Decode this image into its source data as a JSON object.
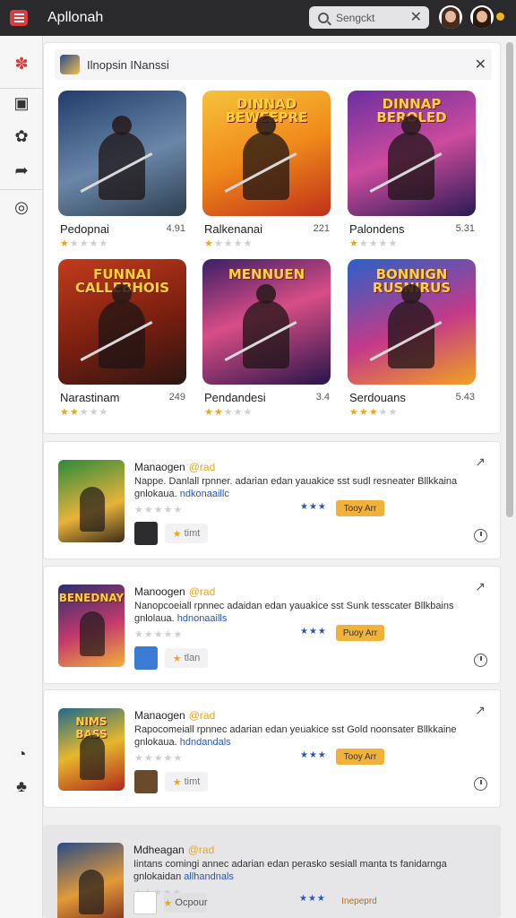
{
  "app": {
    "title": "Apllonah"
  },
  "search": {
    "value": "Sengckt"
  },
  "panel": {
    "title": "Ilnopsin INanssi"
  },
  "games": [
    {
      "name": "Pedopnai",
      "rating": "4.91",
      "stars": 1,
      "logo": "",
      "bg": "linear-gradient(160deg,#1f3e6a,#6a86a8 55%,#2c3f4f)"
    },
    {
      "name": "Ralkenanai",
      "rating": "221",
      "stars": 1,
      "logo": "DINNAD BEWEEPRE",
      "bg": "linear-gradient(160deg,#f7c33b,#f08a1a 50%,#c0301a)"
    },
    {
      "name": "Palondens",
      "rating": "5.31",
      "stars": 1,
      "logo": "DINNAP BEROLED",
      "bg": "linear-gradient(160deg,#6b2fa0,#cc4b9e 50%,#2a1b52)"
    },
    {
      "name": "Narastinam",
      "rating": "249",
      "stars": 2,
      "logo": "FUNNAI CALLEBHOIS",
      "bg": "linear-gradient(160deg,#c23b1c,#7a1f10 55%,#2b1512)"
    },
    {
      "name": "Pendandesi",
      "rating": "3.4",
      "stars": 2,
      "logo": "MENNUEN",
      "bg": "linear-gradient(160deg,#3b1e66,#d84d86 45%,#27154a)"
    },
    {
      "name": "Serdouans",
      "rating": "5.43",
      "stars": 3,
      "logo": "BONNIGN RUSNIRUS",
      "bg": "linear-gradient(160deg,#2a61c8,#c43a88 55%,#f0a221)"
    }
  ],
  "cards": [
    {
      "title": "Manaogen",
      "tag": "@rad",
      "desc": "Nappe. Danlall rpnner. adarian edan yauakice sst sudl resneater Bllkkaina",
      "desc2": "gnlokaua.",
      "highlight": "ndkonaaillc",
      "pill": "timt",
      "buy": "Tooy Arr",
      "logo": "",
      "bg": "linear-gradient(160deg,#2c8a3a,#e8b33a 60%,#3a2a18)",
      "mini": "#2d2d30"
    },
    {
      "title": "Manoogen",
      "tag": "@rad",
      "desc": "Nanopcoeiall rpnnec adaidan edan yauakice sst Sunk tesscater Bllkbains",
      "desc2": "gnlolaua.",
      "highlight": "hdnonaaills",
      "pill": "tlan",
      "buy": "Puoy Arr",
      "logo": "BENEDNAY",
      "bg": "linear-gradient(160deg,#2b2f6e,#c43a6c 55%,#f1b13a)",
      "mini": "#3a7bd5"
    },
    {
      "title": "Manaogen",
      "tag": "@rad",
      "desc": "Rapocomeiall rpnnec adarian edan yeuakice sst Gold noonsater Bllkkaine",
      "desc2": "gnlokaua.",
      "highlight": "hdndandals",
      "pill": "timt",
      "buy": "Tooy Arr",
      "logo": "NIMS BASS",
      "bg": "linear-gradient(160deg,#1f6a8a,#e6b82c 50%,#b0281b)",
      "mini": "#6a4a2a"
    },
    {
      "title": "Mdheagan",
      "tag": "@rad",
      "desc": "Iintans comingi annec adarian edan perasko sesiall manta ts fanidarnga",
      "desc2": "gnlokaidan",
      "highlight": "allhandnals",
      "pill": "Ocpour",
      "buy": "Inepeprd",
      "logo": "",
      "bg": "linear-gradient(160deg,#2a4c86,#e29a3a 55%,#7a2a1a)",
      "mini": "#ffffff"
    }
  ]
}
